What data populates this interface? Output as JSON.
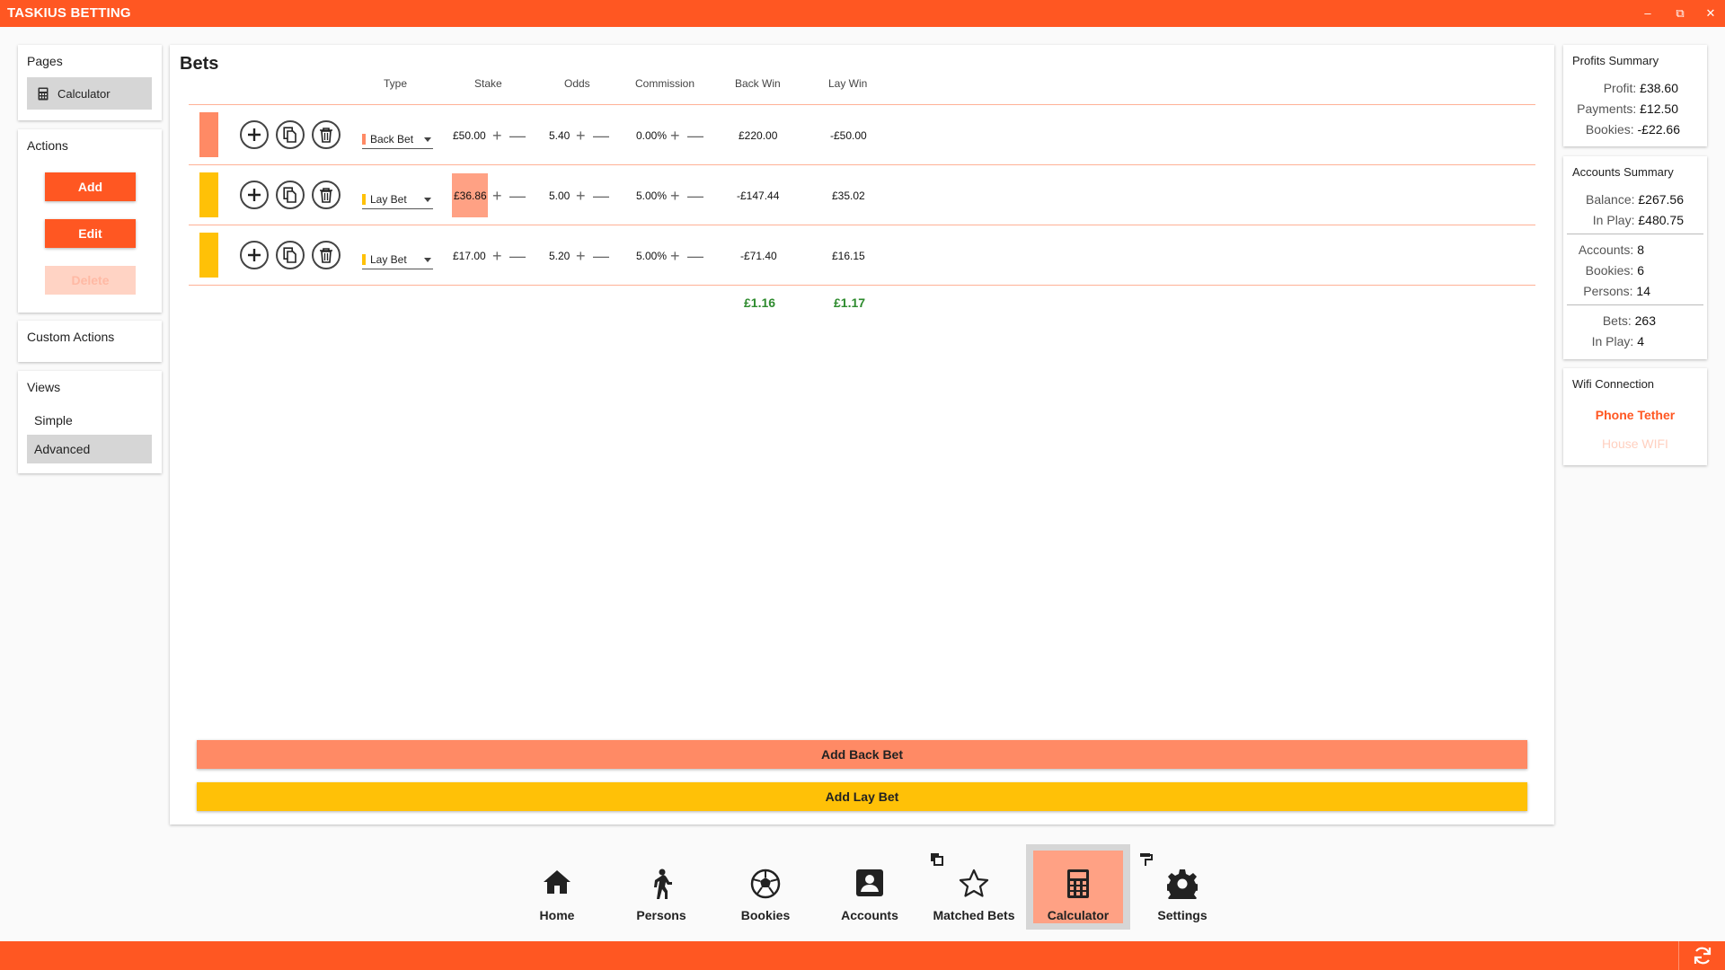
{
  "app": {
    "title": "TASKIUS BETTING"
  },
  "window_controls": {
    "minimize": "–",
    "restore": "⧉",
    "close": "✕"
  },
  "colors": {
    "brand": "#ff5722",
    "back_bet": "#ff8a65",
    "lay_bet": "#ffc107",
    "highlight": "#ffa184",
    "positive": "#2e8b2e"
  },
  "pages_panel": {
    "title": "Pages",
    "items": [
      {
        "label": "Calculator",
        "icon": "calculator-icon",
        "selected": true
      }
    ]
  },
  "actions_panel": {
    "title": "Actions",
    "buttons": {
      "add": "Add",
      "edit": "Edit",
      "delete": "Delete"
    },
    "delete_enabled": false
  },
  "custom_actions_panel": {
    "title": "Custom Actions"
  },
  "views_panel": {
    "title": "Views",
    "items": [
      {
        "label": "Simple",
        "selected": false
      },
      {
        "label": "Advanced",
        "selected": true
      }
    ]
  },
  "bets": {
    "title": "Bets",
    "columns": {
      "type": "Type",
      "stake": "Stake",
      "odds": "Odds",
      "commission": "Commission",
      "back_win": "Back Win",
      "lay_win": "Lay Win"
    },
    "rows": [
      {
        "kind": "back",
        "type": "Back Bet",
        "stake": "£50.00",
        "odds": "5.40",
        "commission": "0.00%",
        "back_win": "£220.00",
        "lay_win": "-£50.00",
        "stake_highlighted": false
      },
      {
        "kind": "lay",
        "type": "Lay Bet",
        "stake": "£36.86",
        "odds": "5.00",
        "commission": "5.00%",
        "back_win": "-£147.44",
        "lay_win": "£35.02",
        "stake_highlighted": true
      },
      {
        "kind": "lay",
        "type": "Lay Bet",
        "stake": "£17.00",
        "odds": "5.20",
        "commission": "5.00%",
        "back_win": "-£71.40",
        "lay_win": "£16.15",
        "stake_highlighted": false
      }
    ],
    "totals": {
      "back_win": "£1.16",
      "lay_win": "£1.17"
    },
    "row_icons": [
      "add-circle-icon",
      "copy-icon",
      "trash-icon"
    ],
    "add_back_bet": "Add Back Bet",
    "add_lay_bet": "Add Lay Bet"
  },
  "profits_summary": {
    "title": "Profits Summary",
    "rows": [
      {
        "label": "Profit:",
        "value": "£38.60"
      },
      {
        "label": "Payments:",
        "value": "£12.50"
      },
      {
        "label": "Bookies:",
        "value": "-£22.66"
      }
    ]
  },
  "accounts_summary": {
    "title": "Accounts Summary",
    "group1": [
      {
        "label": "Balance:",
        "value": "£267.56"
      },
      {
        "label": "In Play:",
        "value": "£480.75"
      }
    ],
    "group2": [
      {
        "label": "Accounts:",
        "value": "8"
      },
      {
        "label": "Bookies:",
        "value": "6"
      },
      {
        "label": "Persons:",
        "value": "14"
      }
    ],
    "group3": [
      {
        "label": "Bets:",
        "value": "263"
      },
      {
        "label": "In Play:",
        "value": "4"
      }
    ]
  },
  "wifi_panel": {
    "title": "Wifi Connection",
    "options": [
      {
        "label": "Phone Tether",
        "active": true
      },
      {
        "label": "House WIFI",
        "active": false
      }
    ]
  },
  "bottom_nav": [
    {
      "label": "Home",
      "icon": "home-icon",
      "active": false
    },
    {
      "label": "Persons",
      "icon": "walking-person-icon",
      "active": false
    },
    {
      "label": "Bookies",
      "icon": "soccer-ball-icon",
      "active": false
    },
    {
      "label": "Accounts",
      "icon": "account-box-icon",
      "active": false
    },
    {
      "label": "Matched Bets",
      "icon": "star-icon",
      "active": false
    },
    {
      "label": "Calculator",
      "icon": "calculator-icon",
      "active": true
    },
    {
      "label": "Settings",
      "icon": "gear-icon",
      "active": false
    }
  ]
}
